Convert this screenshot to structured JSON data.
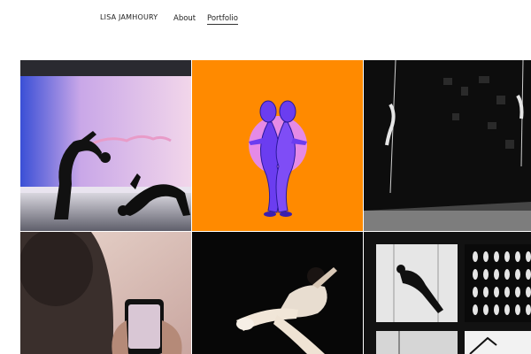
{
  "site": {
    "brand": "LISA JAMHOURY"
  },
  "nav": {
    "items": [
      {
        "label": "About"
      },
      {
        "label": "Portfolio",
        "active": true
      }
    ]
  },
  "portfolio": {
    "tiles": [
      {
        "name": "performance-dancers-projection"
      },
      {
        "name": "purple-figure-orange-backdrop"
      },
      {
        "name": "aerial-performance-dark-stage"
      },
      {
        "name": "phone-recording-audience"
      },
      {
        "name": "dancer-spotlight"
      },
      {
        "name": "aerial-photo-collage"
      }
    ]
  }
}
